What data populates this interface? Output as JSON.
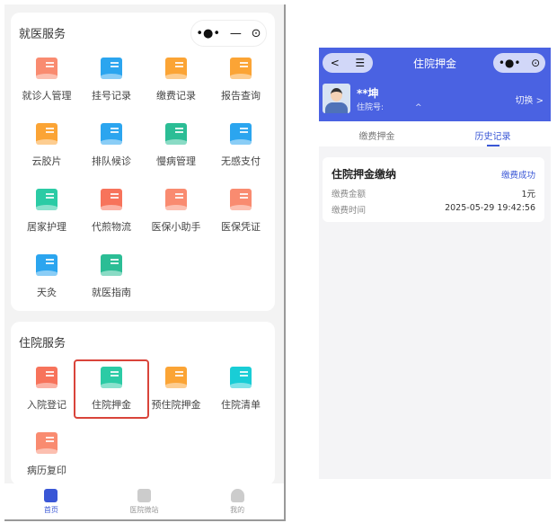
{
  "left": {
    "sections": [
      {
        "title": "就医服务",
        "items": [
          {
            "label": "就诊人管理",
            "color": "#f98b70"
          },
          {
            "label": "挂号记录",
            "color": "#2ba5ef"
          },
          {
            "label": "缴费记录",
            "color": "#fba435"
          },
          {
            "label": "报告查询",
            "color": "#fba435"
          },
          {
            "label": "云胶片",
            "color": "#fba435"
          },
          {
            "label": "排队候诊",
            "color": "#2ba5ef"
          },
          {
            "label": "慢病管理",
            "color": "#2bbd95"
          },
          {
            "label": "无感支付",
            "color": "#2ba5ef"
          },
          {
            "label": "居家护理",
            "color": "#2bcba5"
          },
          {
            "label": "代煎物流",
            "color": "#f7735b"
          },
          {
            "label": "医保小助手",
            "color": "#f98b70"
          },
          {
            "label": "医保凭证",
            "color": "#f98b70"
          },
          {
            "label": "天灸",
            "color": "#2ba5ef"
          },
          {
            "label": "就医指南",
            "color": "#2bbd95"
          }
        ]
      },
      {
        "title": "住院服务",
        "items": [
          {
            "label": "入院登记",
            "color": "#f7735b"
          },
          {
            "label": "住院押金",
            "color": "#2bcba5"
          },
          {
            "label": "预住院押金",
            "color": "#fba435"
          },
          {
            "label": "住院清单",
            "color": "#19cdd6"
          },
          {
            "label": "病历复印",
            "color": "#f98b70"
          }
        ]
      }
    ],
    "capsule": {
      "more": "•●•",
      "minimize": "—",
      "close": "⊙"
    },
    "tabbar": [
      {
        "label": "首页",
        "active": true
      },
      {
        "label": "医院微站"
      },
      {
        "label": "我的"
      }
    ]
  },
  "right": {
    "title": "住院押金",
    "back": "<",
    "menu": "☰",
    "more": "•●•",
    "close": "⊙",
    "patient": {
      "name": "**坤",
      "id_label": "住院号:",
      "id_value": "^",
      "switch": "切换 >"
    },
    "tabs": [
      {
        "label": "缴费押金"
      },
      {
        "label": "历史记录",
        "active": true
      }
    ],
    "record": {
      "title": "住院押金缴纳",
      "status": "缴费成功",
      "amount_label": "缴费金额",
      "amount": "1元",
      "time_label": "缴费时间",
      "time": "2025-05-29 19:42:56"
    }
  },
  "accent": "#4a62e2"
}
